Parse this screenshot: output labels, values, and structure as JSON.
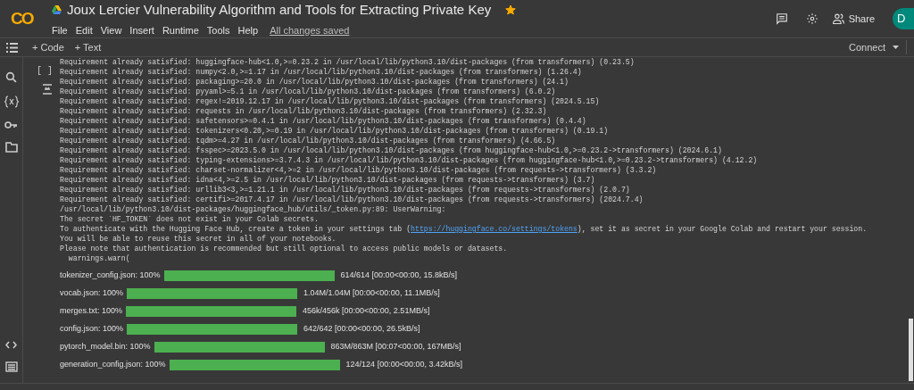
{
  "header": {
    "logo": "CO",
    "title": "Joux Lercier Vulnerability Algorithm and Tools for Extracting Private Key",
    "starred": true,
    "menu": [
      "File",
      "Edit",
      "View",
      "Insert",
      "Runtime",
      "Tools",
      "Help"
    ],
    "save_status": "All changes saved",
    "share": "Share",
    "avatar": "D"
  },
  "toolbar": {
    "add_code": "+ Code",
    "add_text": "+ Text",
    "connect": "Connect"
  },
  "cell": {
    "run_status": "[ ]",
    "output": [
      {
        "kind": "text",
        "text": "Requirement already satisfied: huggingface-hub<1.0,>=0.23.2 in /usr/local/lib/python3.10/dist-packages (from transformers) (0.23.5)"
      },
      {
        "kind": "text",
        "text": "Requirement already satisfied: numpy<2.0,>=1.17 in /usr/local/lib/python3.10/dist-packages (from transformers) (1.26.4)"
      },
      {
        "kind": "text",
        "text": "Requirement already satisfied: packaging>=20.0 in /usr/local/lib/python3.10/dist-packages (from transformers) (24.1)"
      },
      {
        "kind": "text",
        "text": "Requirement already satisfied: pyyaml>=5.1 in /usr/local/lib/python3.10/dist-packages (from transformers) (6.0.2)"
      },
      {
        "kind": "text",
        "text": "Requirement already satisfied: regex!=2019.12.17 in /usr/local/lib/python3.10/dist-packages (from transformers) (2024.5.15)"
      },
      {
        "kind": "text",
        "text": "Requirement already satisfied: requests in /usr/local/lib/python3.10/dist-packages (from transformers) (2.32.3)"
      },
      {
        "kind": "text",
        "text": "Requirement already satisfied: safetensors>=0.4.1 in /usr/local/lib/python3.10/dist-packages (from transformers) (0.4.4)"
      },
      {
        "kind": "text",
        "text": "Requirement already satisfied: tokenizers<0.20,>=0.19 in /usr/local/lib/python3.10/dist-packages (from transformers) (0.19.1)"
      },
      {
        "kind": "text",
        "text": "Requirement already satisfied: tqdm>=4.27 in /usr/local/lib/python3.10/dist-packages (from transformers) (4.66.5)"
      },
      {
        "kind": "text",
        "text": "Requirement already satisfied: fsspec>=2023.5.0 in /usr/local/lib/python3.10/dist-packages (from huggingface-hub<1.0,>=0.23.2->transformers) (2024.6.1)"
      },
      {
        "kind": "text",
        "text": "Requirement already satisfied: typing-extensions>=3.7.4.3 in /usr/local/lib/python3.10/dist-packages (from huggingface-hub<1.0,>=0.23.2->transformers) (4.12.2)"
      },
      {
        "kind": "text",
        "text": "Requirement already satisfied: charset-normalizer<4,>=2 in /usr/local/lib/python3.10/dist-packages (from requests->transformers) (3.3.2)"
      },
      {
        "kind": "text",
        "text": "Requirement already satisfied: idna<4,>=2.5 in /usr/local/lib/python3.10/dist-packages (from requests->transformers) (3.7)"
      },
      {
        "kind": "text",
        "text": "Requirement already satisfied: urllib3<3,>=1.21.1 in /usr/local/lib/python3.10/dist-packages (from requests->transformers) (2.0.7)"
      },
      {
        "kind": "text",
        "text": "Requirement already satisfied: certifi>=2017.4.17 in /usr/local/lib/python3.10/dist-packages (from requests->transformers) (2024.7.4)"
      },
      {
        "kind": "text",
        "text": "/usr/local/lib/python3.10/dist-packages/huggingface_hub/utils/_token.py:89: UserWarning:"
      },
      {
        "kind": "text",
        "text": "The secret `HF_TOKEN` does not exist in your Colab secrets."
      },
      {
        "kind": "link",
        "before": "To authenticate with the Hugging Face Hub, create a token in your settings tab (",
        "link": "https://huggingface.co/settings/tokens",
        "after": "), set it as secret in your Google Colab and restart your session."
      },
      {
        "kind": "text",
        "text": "You will be able to reuse this secret in all of your notebooks."
      },
      {
        "kind": "text",
        "text": "Please note that authentication is recommended but still optional to access public models or datasets."
      },
      {
        "kind": "text",
        "text": "  warnings.warn("
      }
    ],
    "downloads": [
      {
        "label": "tokenizer_config.json: 100%",
        "level": 1,
        "stats": "614/614 [00:00<00:00, 15.8kB/s]"
      },
      {
        "label": "vocab.json: 100%",
        "level": 1,
        "stats": "1.04M/1.04M [00:00<00:00, 11.1MB/s]"
      },
      {
        "label": "merges.txt: 100%",
        "level": 1,
        "stats": "456k/456k [00:00<00:00, 2.51MB/s]"
      },
      {
        "label": "config.json: 100%",
        "level": 1,
        "stats": "642/642 [00:00<00:00, 26.5kB/s]"
      },
      {
        "label": "pytorch_model.bin: 100%",
        "level": 1,
        "stats": "863M/863M [00:07<00:00, 167MB/s]"
      },
      {
        "label": "generation_config.json: 100%",
        "level": 1,
        "stats": "124/124 [00:00<00:00, 3.42kB/s]"
      }
    ]
  }
}
